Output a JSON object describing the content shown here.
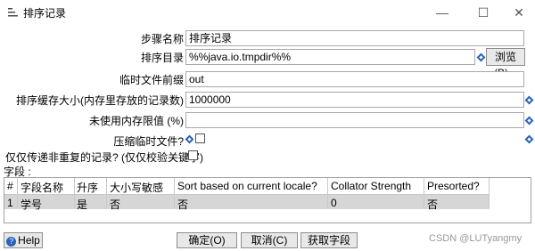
{
  "window": {
    "title": "排序记录",
    "min_symbol": "—",
    "max_symbol": "☐",
    "close_symbol": "✕"
  },
  "form": {
    "step_name_label": "步骤名称",
    "step_name_value": "排序记录",
    "sort_dir_label": "排序目录",
    "sort_dir_value": "%%java.io.tmpdir%%",
    "browse_label": "浏览(B)...",
    "temp_prefix_label": "临时文件前缀",
    "temp_prefix_value": "out",
    "sort_buffer_label": "排序缓存大小(内存里存放的记录数)",
    "sort_buffer_value": "1000000",
    "free_mem_label": "未使用内存限值 (%)",
    "free_mem_value": "",
    "compress_label": "压缩临时文件?",
    "unique_label": "仅仅传递非重复的记录? (仅仅校验关键字)",
    "fields_label": "字段 :"
  },
  "table": {
    "columns": [
      "#",
      "字段名称",
      "升序",
      "大小写敏感",
      "Sort based on current locale?",
      "Collator Strength",
      "Presorted?"
    ],
    "rows": [
      [
        "1",
        "学号",
        "是",
        "否",
        "否",
        "0",
        "否"
      ]
    ]
  },
  "buttons": {
    "help": "Help",
    "ok": "确定(O)",
    "cancel": "取消(C)",
    "get_fields": "获取字段"
  },
  "watermark": "CSDN @LUTyangmy",
  "icons": {
    "variable": "diamond-variable-icon",
    "help": "help-icon",
    "title": "sort-icon"
  }
}
